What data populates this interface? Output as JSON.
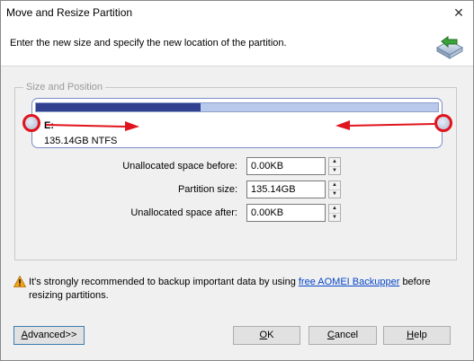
{
  "window": {
    "title": "Move and Resize Partition",
    "close_glyph": "✕"
  },
  "header": {
    "instruction": "Enter the new size and specify the new location of the partition.",
    "icon": "disk-resize-icon"
  },
  "group": {
    "label": "Size and Position"
  },
  "partition": {
    "name": "E:",
    "summary": "135.14GB NTFS",
    "used_fraction": 0.41,
    "bar_used_color": "#31408f",
    "bar_free_color": "#b9c9ec",
    "handle_ring_color": "#e0141e"
  },
  "fields": [
    {
      "label": "Unallocated space before:",
      "value": "0.00KB"
    },
    {
      "label": "Partition size:",
      "value": "135.14GB"
    },
    {
      "label": "Unallocated space after:",
      "value": "0.00KB"
    }
  ],
  "warning": {
    "prefix": "It's strongly recommended to backup important data by using",
    "link": "free AOMEI Backupper",
    "suffix": "before resizing partitions."
  },
  "buttons": {
    "advanced_mnemonic": "A",
    "advanced_rest": "dvanced>>",
    "ok_mnemonic": "O",
    "ok_rest": "K",
    "cancel_mnemonic": "C",
    "cancel_rest": "ancel",
    "help_mnemonic": "H",
    "help_rest": "elp"
  }
}
